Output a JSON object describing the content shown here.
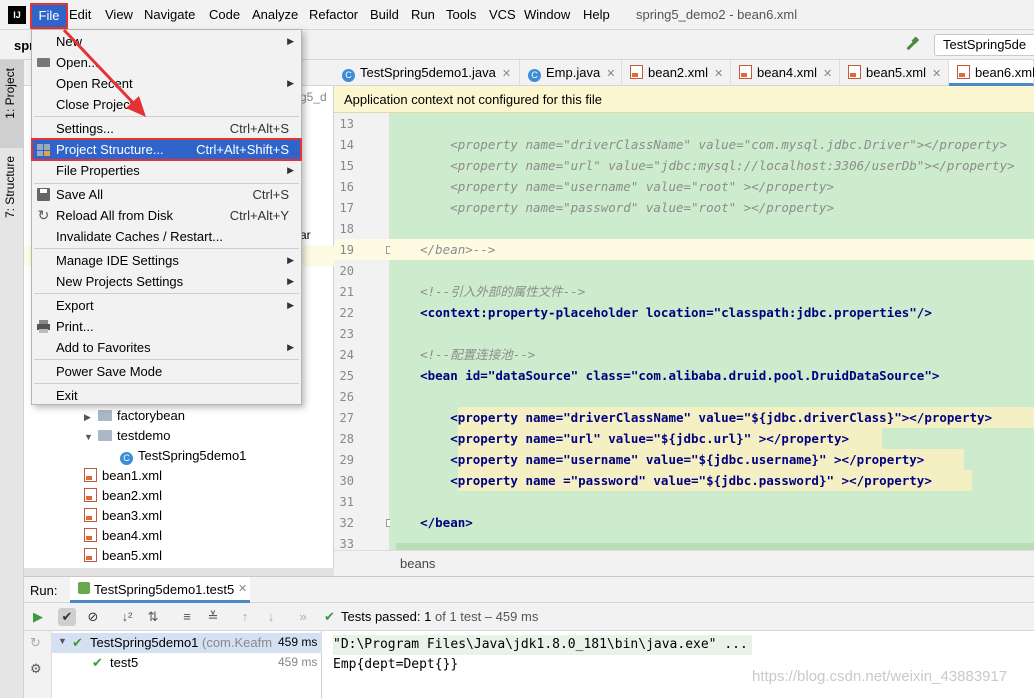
{
  "menubar": {
    "app_icon": "IJ",
    "items": [
      "File",
      "Edit",
      "View",
      "Navigate",
      "Code",
      "Analyze",
      "Refactor",
      "Build",
      "Run",
      "Tools",
      "VCS",
      "Window",
      "Help"
    ],
    "window_title": "spring5_demo2 - bean6.xml"
  },
  "toolbar": {
    "project_abbrev": "spr",
    "run_config": "TestSpring5de"
  },
  "stripe": {
    "project": "1: Project",
    "structure": "7: Structure"
  },
  "project_panel": {
    "partial_texts": [
      "g5_d",
      "ar"
    ],
    "tree": [
      {
        "label": "factorybean",
        "kind": "folder",
        "collapsed": true
      },
      {
        "label": "testdemo",
        "kind": "folder",
        "collapsed": false
      },
      {
        "label": "TestSpring5demo1",
        "kind": "class"
      },
      {
        "label": "bean1.xml",
        "kind": "xml"
      },
      {
        "label": "bean2.xml",
        "kind": "xml"
      },
      {
        "label": "bean3.xml",
        "kind": "xml"
      },
      {
        "label": "bean4.xml",
        "kind": "xml"
      },
      {
        "label": "bean5.xml",
        "kind": "xml"
      }
    ]
  },
  "file_menu": {
    "items": [
      {
        "label": "New",
        "submenu": true
      },
      {
        "label": "Open...",
        "icon": "folder-open-icon"
      },
      {
        "label": "Open Recent",
        "submenu": true
      },
      {
        "label": "Close Project"
      },
      {
        "separator": true
      },
      {
        "label": "Settings...",
        "shortcut": "Ctrl+Alt+S"
      },
      {
        "label": "Project Structure...",
        "shortcut": "Ctrl+Alt+Shift+S",
        "selected": true,
        "icon": "project-structure-icon"
      },
      {
        "label": "File Properties",
        "submenu": true
      },
      {
        "separator": true
      },
      {
        "label": "Save All",
        "shortcut": "Ctrl+S",
        "icon": "save-icon"
      },
      {
        "label": "Reload All from Disk",
        "shortcut": "Ctrl+Alt+Y",
        "icon": "reload-icon"
      },
      {
        "label": "Invalidate Caches / Restart..."
      },
      {
        "separator": true
      },
      {
        "label": "Manage IDE Settings",
        "submenu": true
      },
      {
        "label": "New Projects Settings",
        "submenu": true
      },
      {
        "separator": true
      },
      {
        "label": "Export",
        "submenu": true
      },
      {
        "label": "Print...",
        "icon": "print-icon"
      },
      {
        "label": "Add to Favorites",
        "submenu": true
      },
      {
        "separator": true
      },
      {
        "label": "Power Save Mode"
      },
      {
        "separator": true
      },
      {
        "label": "Exit"
      }
    ]
  },
  "editor": {
    "tabs": [
      {
        "label": "TestSpring5demo1.java",
        "icon": "class-icon"
      },
      {
        "label": "Emp.java",
        "icon": "class-icon"
      },
      {
        "label": "bean2.xml",
        "icon": "xml-icon"
      },
      {
        "label": "bean4.xml",
        "icon": "xml-icon"
      },
      {
        "label": "bean5.xml",
        "icon": "xml-icon"
      },
      {
        "label": "bean6.xml",
        "icon": "xml-icon",
        "active": true
      }
    ],
    "banner": "Application context not configured for this file",
    "lines": [
      {
        "n": "13",
        "text": ""
      },
      {
        "n": "14",
        "text": "        <property name=\"driverClassName\" value=\"com.mysql.jdbc.Driver\"></property>",
        "style": "cm"
      },
      {
        "n": "15",
        "text": "        <property name=\"url\" value=\"jdbc:mysql://localhost:3306/userDb\"></property>",
        "style": "cm"
      },
      {
        "n": "16",
        "text": "        <property name=\"username\" value=\"root\" ></property>",
        "style": "cm"
      },
      {
        "n": "17",
        "text": "        <property name=\"password\" value=\"root\" ></property>",
        "style": "cm"
      },
      {
        "n": "18",
        "text": ""
      },
      {
        "n": "19",
        "text": "    </bean>-->",
        "style": "cm"
      },
      {
        "n": "20",
        "text": ""
      },
      {
        "n": "21",
        "text": "    <!--引入外部的属性文件-->",
        "style": "cm"
      },
      {
        "n": "22",
        "text": "    <context:property-placeholder location=\"classpath:jdbc.properties\"/>",
        "style": "code"
      },
      {
        "n": "23",
        "text": ""
      },
      {
        "n": "24",
        "text": "    <!--配置连接池-->",
        "style": "cm"
      },
      {
        "n": "25",
        "text": "    <bean id=\"dataSource\" class=\"com.alibaba.druid.pool.DruidDataSource\">",
        "style": "code"
      },
      {
        "n": "26",
        "text": ""
      },
      {
        "n": "27",
        "text": "        <property name=\"driverClassName\" value=\"${jdbc.driverClass}\"></property>",
        "style": "code"
      },
      {
        "n": "28",
        "text": "        <property name=\"url\" value=\"${jdbc.url}\" ></property>",
        "style": "code"
      },
      {
        "n": "29",
        "text": "        <property name=\"username\" value=\"${jdbc.username}\" ></property>",
        "style": "code"
      },
      {
        "n": "30",
        "text": "        <property name =\"password\" value=\"${jdbc.password}\" ></property>",
        "style": "code"
      },
      {
        "n": "31",
        "text": ""
      },
      {
        "n": "32",
        "text": "    </bean>",
        "style": "code"
      },
      {
        "n": "33",
        "text": ""
      }
    ],
    "breadcrumb": "beans"
  },
  "run_panel": {
    "label": "Run:",
    "tab": "TestSpring5demo1.test5",
    "status_prefix": "Tests passed:",
    "status_count": "1",
    "status_suffix": "of 1 test – 459 ms",
    "tree": [
      {
        "label": "TestSpring5demo1",
        "detail": "(com.Keafm",
        "time": "459 ms"
      },
      {
        "label": "test5",
        "time": "459 ms"
      }
    ],
    "console": [
      "\"D:\\Program Files\\Java\\jdk1.8.0_181\\bin\\java.exe\" ...",
      "Emp{dept=Dept{}}"
    ]
  },
  "watermark": "https://blog.csdn.net/weixin_43883917",
  "colors": {
    "accent": "#2f65ca",
    "highlight_red": "#e53333",
    "code_bg": "#cdeccd",
    "banner": "#fdf7d1"
  }
}
